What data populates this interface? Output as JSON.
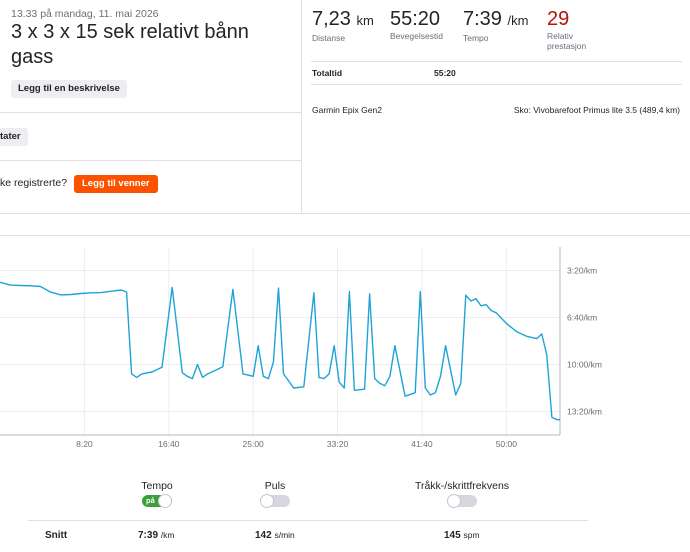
{
  "activity": {
    "datetime": "13.33 på mandag, 11. mai 2026",
    "title": "3 x 3 x 15 sek relativt bånn gass",
    "add_description_label": "Legg til en beskrivelse",
    "tag_button_label": "tater",
    "register_prompt": "ke registrerte?",
    "add_friends_label": "Legg til venner"
  },
  "stats": [
    {
      "value": "7,23",
      "unit": "km",
      "label": "Distanse"
    },
    {
      "value": "55:20",
      "unit": "",
      "label": "Bevegelsestid"
    },
    {
      "value": "7:39",
      "unit": "/km",
      "label": "Tempo"
    },
    {
      "value": "29",
      "unit": "",
      "label": "Relativ prestasjon"
    }
  ],
  "totals": {
    "label": "Totaltid",
    "value": "55:20"
  },
  "gear": {
    "device": "Garmin Epix Gen2",
    "shoes": "Sko: Vivobarefoot Primus lite 3.5 (489,4 km)"
  },
  "colors": {
    "accent": "#fc5200",
    "relative_effort": "#b5140a",
    "series": "#1fa3d6",
    "toggle_on": "#3aa03a"
  },
  "chart_data": {
    "type": "line",
    "series": [
      {
        "x": [
          0,
          1,
          2,
          3,
          4,
          5,
          6,
          7,
          8,
          9,
          10,
          11,
          12,
          12.5,
          13,
          13.5,
          14,
          15,
          16,
          17,
          18,
          18.5,
          19,
          19.5,
          20,
          20.5,
          21,
          22,
          23,
          24,
          24.5,
          25,
          25.5,
          26,
          26.5,
          27,
          27.5,
          28,
          29,
          30,
          31,
          31.5,
          32,
          32.5,
          33,
          33.5,
          34,
          34.5,
          35,
          36,
          36.5,
          37,
          37.5,
          38,
          38.5,
          39,
          40,
          41,
          41.5,
          42,
          42.5,
          43,
          43.5,
          44,
          45,
          45.5,
          46,
          46.5,
          47,
          47.5,
          48,
          48.5,
          49,
          50,
          51,
          52,
          53,
          53.5,
          54,
          54.5,
          55,
          55.3
        ],
        "pace_sec": [
          250,
          262,
          264,
          265,
          268,
          292,
          304,
          302,
          298,
          295,
          294,
          288,
          283,
          292,
          640,
          655,
          640,
          632,
          612,
          272,
          635,
          650,
          660,
          600,
          655,
          640,
          630,
          610,
          280,
          640,
          645,
          650,
          520,
          650,
          660,
          590,
          275,
          640,
          700,
          695,
          295,
          655,
          660,
          640,
          520,
          675,
          700,
          290,
          710,
          705,
          300,
          660,
          680,
          690,
          650,
          520,
          735,
          720,
          290,
          700,
          730,
          720,
          650,
          520,
          730,
          680,
          305,
          330,
          320,
          350,
          345,
          370,
          380,
          425,
          460,
          480,
          490,
          470,
          560,
          825,
          835,
          835
        ]
      }
    ],
    "x_ticks": [
      "8:20",
      "16:40",
      "25:00",
      "33:20",
      "41:40",
      "50:00"
    ],
    "x_tick_values": [
      8.333,
      16.667,
      25,
      33.333,
      41.667,
      50
    ],
    "y_ticks": [
      "3:20/km",
      "6:40/km",
      "10:00/km",
      "13:20/km"
    ],
    "y_tick_values": [
      200,
      400,
      600,
      800
    ],
    "y_inverted": true,
    "grid": true
  },
  "toggles": [
    {
      "label": "Tempo",
      "state_label": "på",
      "on": true
    },
    {
      "label": "Puls",
      "on": false
    },
    {
      "label": "Tråkk-/skrittfrekvens",
      "on": false
    }
  ],
  "averages": {
    "label": "Snitt",
    "pace": {
      "value": "7:39",
      "unit": "/km"
    },
    "hr": {
      "value": "142",
      "unit": "s/min"
    },
    "cadence": {
      "value": "145",
      "unit": "spm"
    }
  }
}
